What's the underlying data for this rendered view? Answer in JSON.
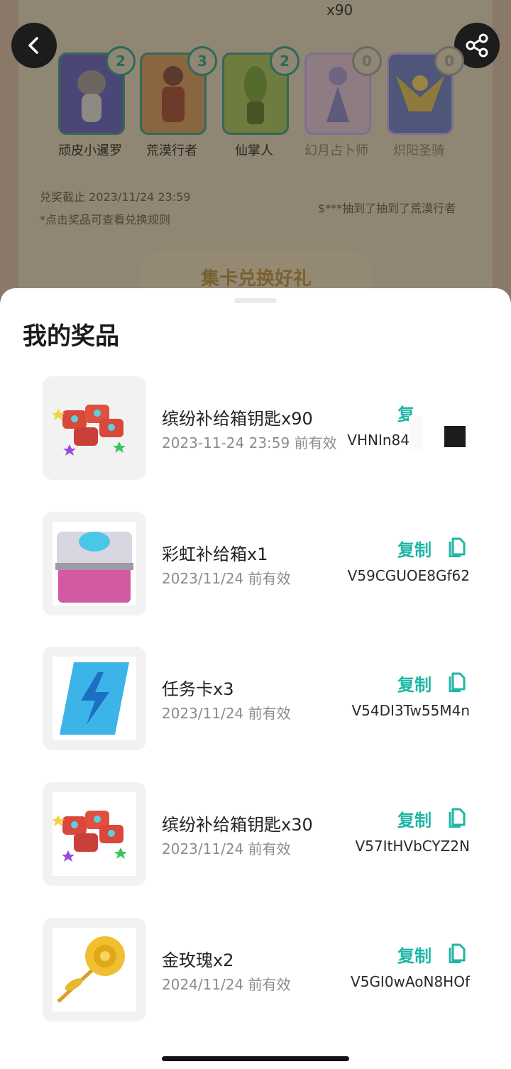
{
  "background": {
    "top_count": "x90",
    "characters": [
      {
        "name": "顽皮小暹罗",
        "count": "2",
        "owned": true
      },
      {
        "name": "荒漠行者",
        "count": "3",
        "owned": true
      },
      {
        "name": "仙掌人",
        "count": "2",
        "owned": true
      },
      {
        "name": "幻月占卜师",
        "count": "0",
        "owned": false
      },
      {
        "name": "炽阳圣骑",
        "count": "0",
        "owned": false
      }
    ],
    "deadline": "兑奖截止 2023/11/24 23:59",
    "hint": "*点击奖品可查看兑换规则",
    "ticker": "$***抽到了抽到了荒漠行者",
    "exchange_button": "集卡兑换好礼"
  },
  "sheet": {
    "title": "我的奖品",
    "copy_label": "复制",
    "prizes": [
      {
        "name": "缤纷补给箱钥匙x90",
        "valid": "2023-11-24 23:59 前有效",
        "code": "VHNIn84",
        "copy": "复"
      },
      {
        "name": "彩虹补给箱x1",
        "valid": "2023/11/24 前有效",
        "code": "V59CGUOE8Gf62",
        "copy": "复制"
      },
      {
        "name": "任务卡x3",
        "valid": "2023/11/24 前有效",
        "code": "V54DI3Tw55M4n",
        "copy": "复制"
      },
      {
        "name": "缤纷补给箱钥匙x30",
        "valid": "2023/11/24 前有效",
        "code": "V57ItHVbCYZ2N",
        "copy": "复制"
      },
      {
        "name": "金玫瑰x2",
        "valid": "2024/11/24 前有效",
        "code": "V5GI0wAoN8HOf",
        "copy": "复制"
      }
    ]
  },
  "colors": {
    "accent": "#1fb6a6",
    "sheet_bg": "#ffffff",
    "overlay": "#8f8674"
  }
}
